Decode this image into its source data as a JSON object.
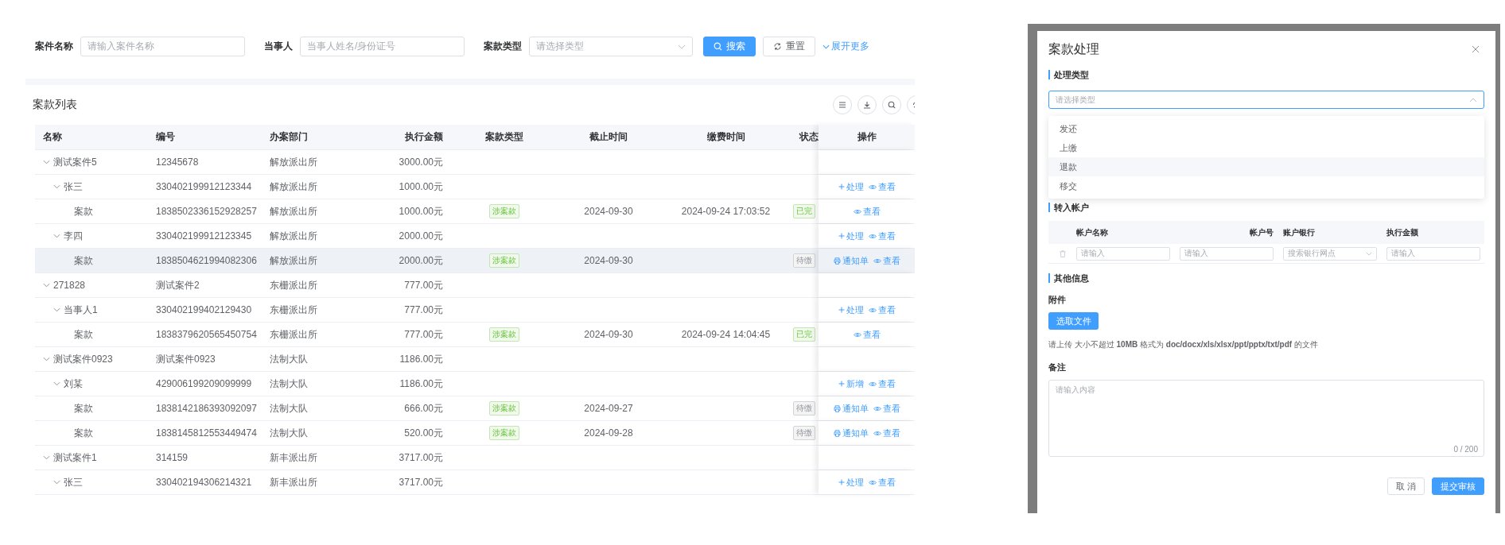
{
  "search": {
    "fields": [
      {
        "label": "案件名称",
        "placeholder": "请输入案件名称",
        "kind": "input"
      },
      {
        "label": "当事人",
        "placeholder": "当事人姓名/身份证号",
        "kind": "input"
      },
      {
        "label": "案款类型",
        "placeholder": "请选择类型",
        "kind": "select"
      }
    ],
    "buttons": [
      {
        "label": "搜索",
        "kind": "primary"
      },
      {
        "label": "重置",
        "kind": "default"
      }
    ],
    "expand_link": "展开更多"
  },
  "table": {
    "title": "案款列表",
    "columns": [
      "名称",
      "编号",
      "办案部门",
      "执行金额",
      "案款类型",
      "截止时间",
      "缴费时间",
      "状态",
      "操作"
    ],
    "rows": [
      {
        "name": "测试案件5",
        "code": "12345678",
        "department": "解放派出所",
        "amount": "3000.00元",
        "selected": false,
        "expanded": true,
        "children": [
          {
            "name": "张三",
            "code": "330402199912123344",
            "department": "解放派出所",
            "amount": "1000.00元",
            "selected": false,
            "expanded": true,
            "actions": [
              {
                "label": "处理",
                "kind": "process"
              },
              {
                "label": "查看",
                "kind": "view"
              }
            ],
            "children": [
              {
                "name": "案款",
                "code": "1838502336152928257",
                "department": "解放派出所",
                "amount": "1000.00元",
                "selected": false,
                "type_tag": "涉案款",
                "deadline": "2024-09-30",
                "paid_time": "2024-09-24 17:03:52",
                "status": {
                  "label": "已完",
                  "kind": "done"
                },
                "actions": [
                  {
                    "label": "查看",
                    "kind": "view"
                  }
                ]
              }
            ]
          },
          {
            "name": "李四",
            "code": "330402199912123345",
            "department": "解放派出所",
            "amount": "2000.00元",
            "selected": false,
            "expanded": true,
            "actions": [
              {
                "label": "处理",
                "kind": "process"
              },
              {
                "label": "查看",
                "kind": "view"
              }
            ],
            "children": [
              {
                "name": "案款",
                "code": "1838504621994082306",
                "department": "解放派出所",
                "amount": "2000.00元",
                "selected": true,
                "type_tag": "涉案款",
                "deadline": "2024-09-30",
                "status": {
                  "label": "待缴",
                  "kind": "pending"
                },
                "actions": [
                  {
                    "label": "通知单",
                    "kind": "notice"
                  },
                  {
                    "label": "查看",
                    "kind": "view"
                  }
                ]
              }
            ]
          }
        ]
      },
      {
        "name": "271828",
        "code": "测试案件2",
        "department": "东栅派出所",
        "amount": "777.00元",
        "selected": false,
        "expanded": true,
        "children": [
          {
            "name": "当事人1",
            "code": "330402199402129430",
            "department": "东栅派出所",
            "amount": "777.00元",
            "selected": false,
            "expanded": true,
            "actions": [
              {
                "label": "处理",
                "kind": "process"
              },
              {
                "label": "查看",
                "kind": "view"
              }
            ],
            "children": [
              {
                "name": "案款",
                "code": "1838379620565450754",
                "department": "东栅派出所",
                "amount": "777.00元",
                "selected": false,
                "type_tag": "涉案款",
                "deadline": "2024-09-30",
                "paid_time": "2024-09-24 14:04:45",
                "status": {
                  "label": "已完",
                  "kind": "done"
                },
                "actions": [
                  {
                    "label": "查看",
                    "kind": "view"
                  }
                ]
              }
            ]
          }
        ]
      },
      {
        "name": "测试案件0923",
        "code": "测试案件0923",
        "department": "法制大队",
        "amount": "1186.00元",
        "selected": false,
        "expanded": true,
        "children": [
          {
            "name": "刘某",
            "code": "429006199209099999",
            "department": "法制大队",
            "amount": "1186.00元",
            "selected": false,
            "expanded": true,
            "actions": [
              {
                "label": "新增",
                "kind": "process"
              },
              {
                "label": "查看",
                "kind": "view"
              }
            ],
            "children": [
              {
                "name": "案款",
                "code": "1838142186393092097",
                "department": "法制大队",
                "amount": "666.00元",
                "selected": false,
                "type_tag": "涉案款",
                "deadline": "2024-09-27",
                "status": {
                  "label": "待缴",
                  "kind": "pending"
                },
                "actions": [
                  {
                    "label": "通知单",
                    "kind": "notice"
                  },
                  {
                    "label": "查看",
                    "kind": "view"
                  }
                ]
              },
              {
                "name": "案款",
                "code": "1838145812553449474",
                "department": "法制大队",
                "amount": "520.00元",
                "selected": false,
                "type_tag": "涉案款",
                "deadline": "2024-09-28",
                "status": {
                  "label": "待缴",
                  "kind": "pending"
                },
                "actions": [
                  {
                    "label": "通知单",
                    "kind": "notice"
                  },
                  {
                    "label": "查看",
                    "kind": "view"
                  }
                ]
              }
            ]
          }
        ]
      },
      {
        "name": "测试案件1",
        "code": "314159",
        "department": "新丰派出所",
        "amount": "3717.00元",
        "selected": false,
        "expanded": true,
        "children": [
          {
            "name": "张三",
            "code": "330402194306214321",
            "department": "新丰派出所",
            "amount": "3717.00元",
            "selected": false,
            "expanded": true,
            "actions": [
              {
                "label": "处理",
                "kind": "process"
              },
              {
                "label": "查看",
                "kind": "view"
              }
            ]
          }
        ]
      }
    ]
  },
  "dialog": {
    "title": "案款处理",
    "type_section": {
      "heading": "处理类型",
      "placeholder": "请选择类型",
      "open": true,
      "options": [
        {
          "label": "发还",
          "selected": false
        },
        {
          "label": "上缴",
          "selected": false
        },
        {
          "label": "退款",
          "selected": true
        },
        {
          "label": "移交",
          "selected": false
        }
      ]
    },
    "account_section": {
      "heading": "转入帐户",
      "columns": [
        "帐户名称",
        "帐户号",
        "账户银行",
        "执行金额"
      ],
      "rows": [
        {
          "fields": [
            {
              "placeholder": "请输入",
              "kind": "input"
            },
            {
              "placeholder": "请输入",
              "kind": "input"
            },
            {
              "placeholder": "搜索银行网点",
              "kind": "select"
            },
            {
              "placeholder": "请输入",
              "kind": "input"
            }
          ]
        }
      ]
    },
    "other_section": {
      "heading": "其他信息",
      "attachment_label": "附件",
      "upload_button": "选取文件",
      "hint": "请上传 大小不超过 **10MB** 格式为 **doc/docx/xls/xlsx/ppt/pptx/txt/pdf** 的文件",
      "remark_label": "备注",
      "remark_placeholder": "请输入内容",
      "counter": "0 / 200"
    },
    "buttons": [
      {
        "label": "取 消",
        "kind": "default"
      },
      {
        "label": "提交审核",
        "kind": "primary"
      }
    ]
  }
}
